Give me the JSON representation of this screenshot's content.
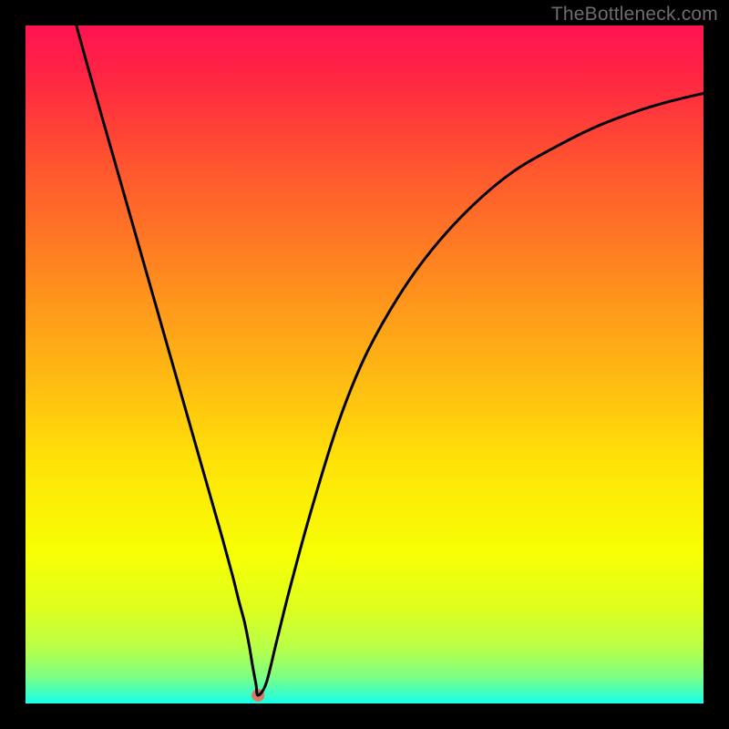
{
  "watermark": "TheBottleneck.com",
  "chart_data": {
    "type": "line",
    "title": "",
    "xlabel": "",
    "ylabel": "",
    "xlim": [
      0,
      100
    ],
    "ylim": [
      0,
      100
    ],
    "grid": false,
    "legend": false,
    "background": {
      "description": "vertical rainbow gradient red→yellow→green",
      "stops": [
        {
          "offset": 0.0,
          "color": "#ff1351"
        },
        {
          "offset": 0.08,
          "color": "#ff2742"
        },
        {
          "offset": 0.2,
          "color": "#ff5330"
        },
        {
          "offset": 0.35,
          "color": "#ff8321"
        },
        {
          "offset": 0.5,
          "color": "#ffb414"
        },
        {
          "offset": 0.65,
          "color": "#ffe408"
        },
        {
          "offset": 0.78,
          "color": "#f7ff04"
        },
        {
          "offset": 0.86,
          "color": "#deff1e"
        },
        {
          "offset": 0.92,
          "color": "#b7ff4b"
        },
        {
          "offset": 0.96,
          "color": "#7eff83"
        },
        {
          "offset": 0.985,
          "color": "#3effc3"
        },
        {
          "offset": 1.0,
          "color": "#17ffeb"
        }
      ]
    },
    "series": [
      {
        "name": "curve",
        "color": "#000000",
        "x": [
          7.5,
          10,
          13,
          16,
          19,
          22,
          25,
          27,
          29,
          30.5,
          31.5,
          32.3,
          33,
          33.5,
          34,
          34.3,
          35.5,
          37,
          39,
          42,
          46,
          50,
          55,
          60,
          66,
          72,
          78,
          84,
          90,
          95,
          100
        ],
        "y": [
          100,
          91,
          80.5,
          70,
          59.5,
          49,
          38.5,
          31.5,
          24.5,
          19,
          15,
          12,
          8.5,
          5.5,
          2.8,
          1.2,
          3,
          9,
          17,
          28,
          41,
          51,
          60,
          67,
          73.5,
          78.5,
          82,
          85,
          87.3,
          88.8,
          90
        ]
      }
    ],
    "marker": {
      "x": 34.3,
      "y": 1.2,
      "color": "#d77a63",
      "radius_px": 7
    }
  }
}
